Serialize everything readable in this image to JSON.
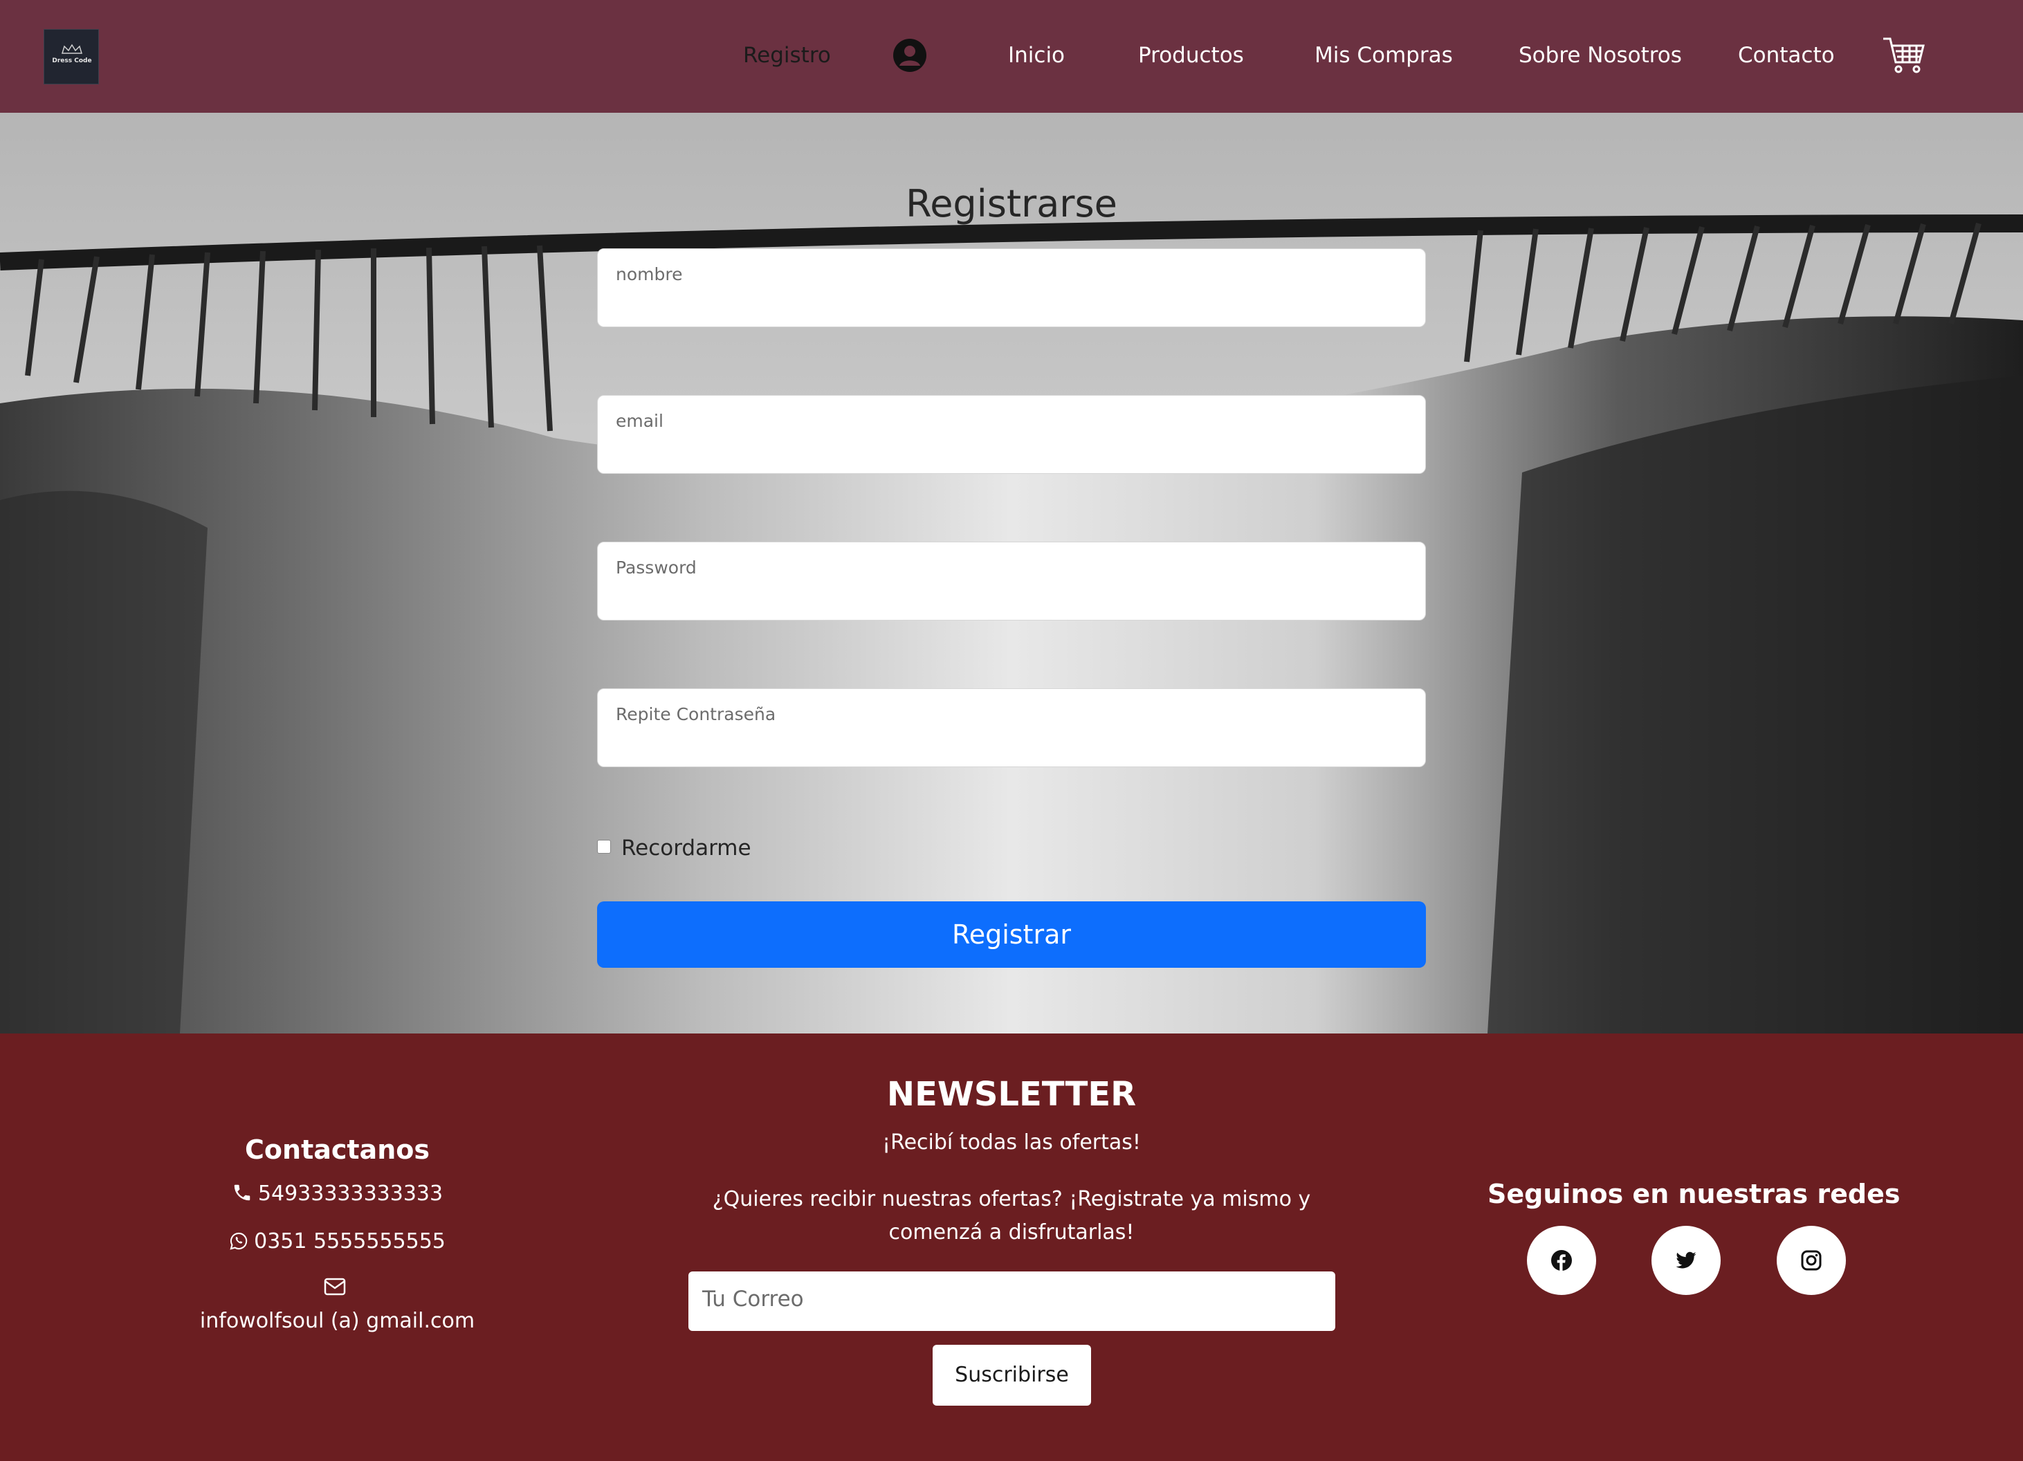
{
  "brand": {
    "logo_text": "Dress Code"
  },
  "nav": {
    "registro": "Registro",
    "inicio": "Inicio",
    "productos": "Productos",
    "mis_compras": "Mis Compras",
    "sobre_nosotros": "Sobre Nosotros",
    "contacto": "Contacto"
  },
  "form": {
    "title": "Registrarse",
    "nombre_placeholder": "nombre",
    "email_placeholder": "email",
    "password_placeholder": "Password",
    "repeat_placeholder": "Repite Contraseña",
    "remember_label": "Recordarme",
    "submit_label": "Registrar"
  },
  "footer": {
    "contact": {
      "title": "Contactanos",
      "phone": "54933333333333",
      "whatsapp": "0351 5555555555",
      "email": "infowolfsoul (a) gmail.com"
    },
    "newsletter": {
      "title": "NEWSLETTER",
      "subtitle": "¡Recibí todas las ofertas!",
      "description": "¿Quieres recibir nuestras ofertas? ¡Registrate ya mismo y comenzá a disfrutarlas!",
      "input_placeholder": "Tu Correo",
      "button_label": "Suscribirse"
    },
    "social": {
      "title": "Seguinos en nuestras redes",
      "icons": [
        "facebook-icon",
        "twitter-icon",
        "instagram-icon"
      ]
    }
  },
  "colors": {
    "navbar": "#6b3141",
    "footer": "#6b1e21",
    "primary_button": "#0d6efd"
  }
}
